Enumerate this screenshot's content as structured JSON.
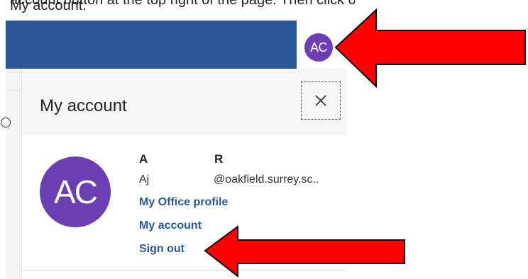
{
  "caption": {
    "text": "account button at the top right of the page. Then click on My account."
  },
  "header": {
    "avatar_initials": "AC"
  },
  "panel": {
    "title": "My account",
    "close_label": "Close"
  },
  "profile": {
    "avatar_initials": "AC",
    "first_name": "A",
    "last_name": "R",
    "email_prefix": "Aj",
    "email_domain": "@oakfield.surrey.sc..",
    "links": {
      "office_profile": "My Office profile",
      "my_account": "My account",
      "sign_out": "Sign out"
    }
  },
  "colors": {
    "header_blue": "#2b579a",
    "avatar_purple": "#6b3fb3",
    "arrow_red": "#ff0000"
  }
}
